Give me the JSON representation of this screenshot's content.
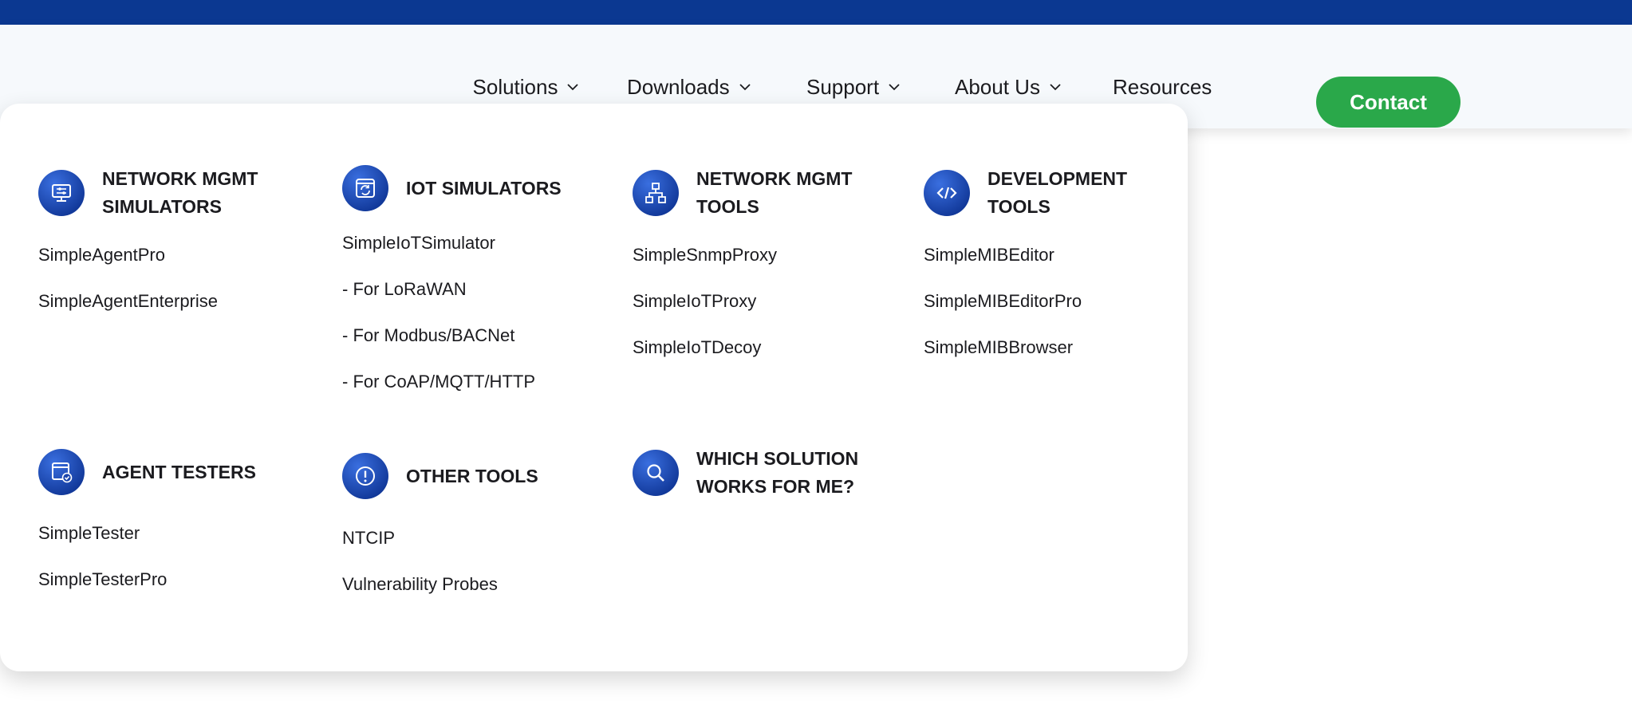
{
  "nav": {
    "items": [
      {
        "label": "Solutions",
        "has_dropdown": true,
        "active": true
      },
      {
        "label": "Downloads",
        "has_dropdown": true
      },
      {
        "label": "Support",
        "has_dropdown": true
      },
      {
        "label": "About Us",
        "has_dropdown": true
      },
      {
        "label": "Resources",
        "has_dropdown": false
      }
    ],
    "contact_label": "Contact"
  },
  "menu": {
    "sections": [
      {
        "title": "NETWORK MGMT SIMULATORS",
        "icon": "monitor-settings-icon",
        "links": [
          "SimpleAgentPro",
          "SimpleAgentEnterprise"
        ]
      },
      {
        "title": "IOT SIMULATORS",
        "icon": "iot-refresh-icon",
        "links": [
          "SimpleIoTSimulator",
          "- For LoRaWAN",
          "- For Modbus/BACNet",
          "- For CoAP/MQTT/HTTP"
        ]
      },
      {
        "title": "NETWORK MGMT TOOLS",
        "icon": "network-hierarchy-icon",
        "links": [
          "SimpleSnmpProxy",
          "SimpleIoTProxy",
          "SimpleIoTDecoy"
        ]
      },
      {
        "title": "DEVELOPMENT TOOLS",
        "icon": "code-icon",
        "links": [
          "SimpleMIBEditor",
          "SimpleMIBEditorPro",
          "SimpleMIBBrowser"
        ]
      },
      {
        "title": "AGENT TESTERS",
        "icon": "window-check-icon",
        "links": [
          "SimpleTester",
          "SimpleTesterPro"
        ]
      },
      {
        "title": "OTHER TOOLS",
        "icon": "alert-circle-icon",
        "links": [
          "NTCIP",
          "Vulnerability Probes"
        ]
      },
      {
        "title": "WHICH SOLUTION WORKS FOR ME?",
        "icon": "search-icon",
        "links": []
      }
    ]
  },
  "colors": {
    "top_bar": "#0b3891",
    "accent": "#2e63d3",
    "contact": "#2aa84a",
    "nav_bg": "#f6f9fc"
  }
}
